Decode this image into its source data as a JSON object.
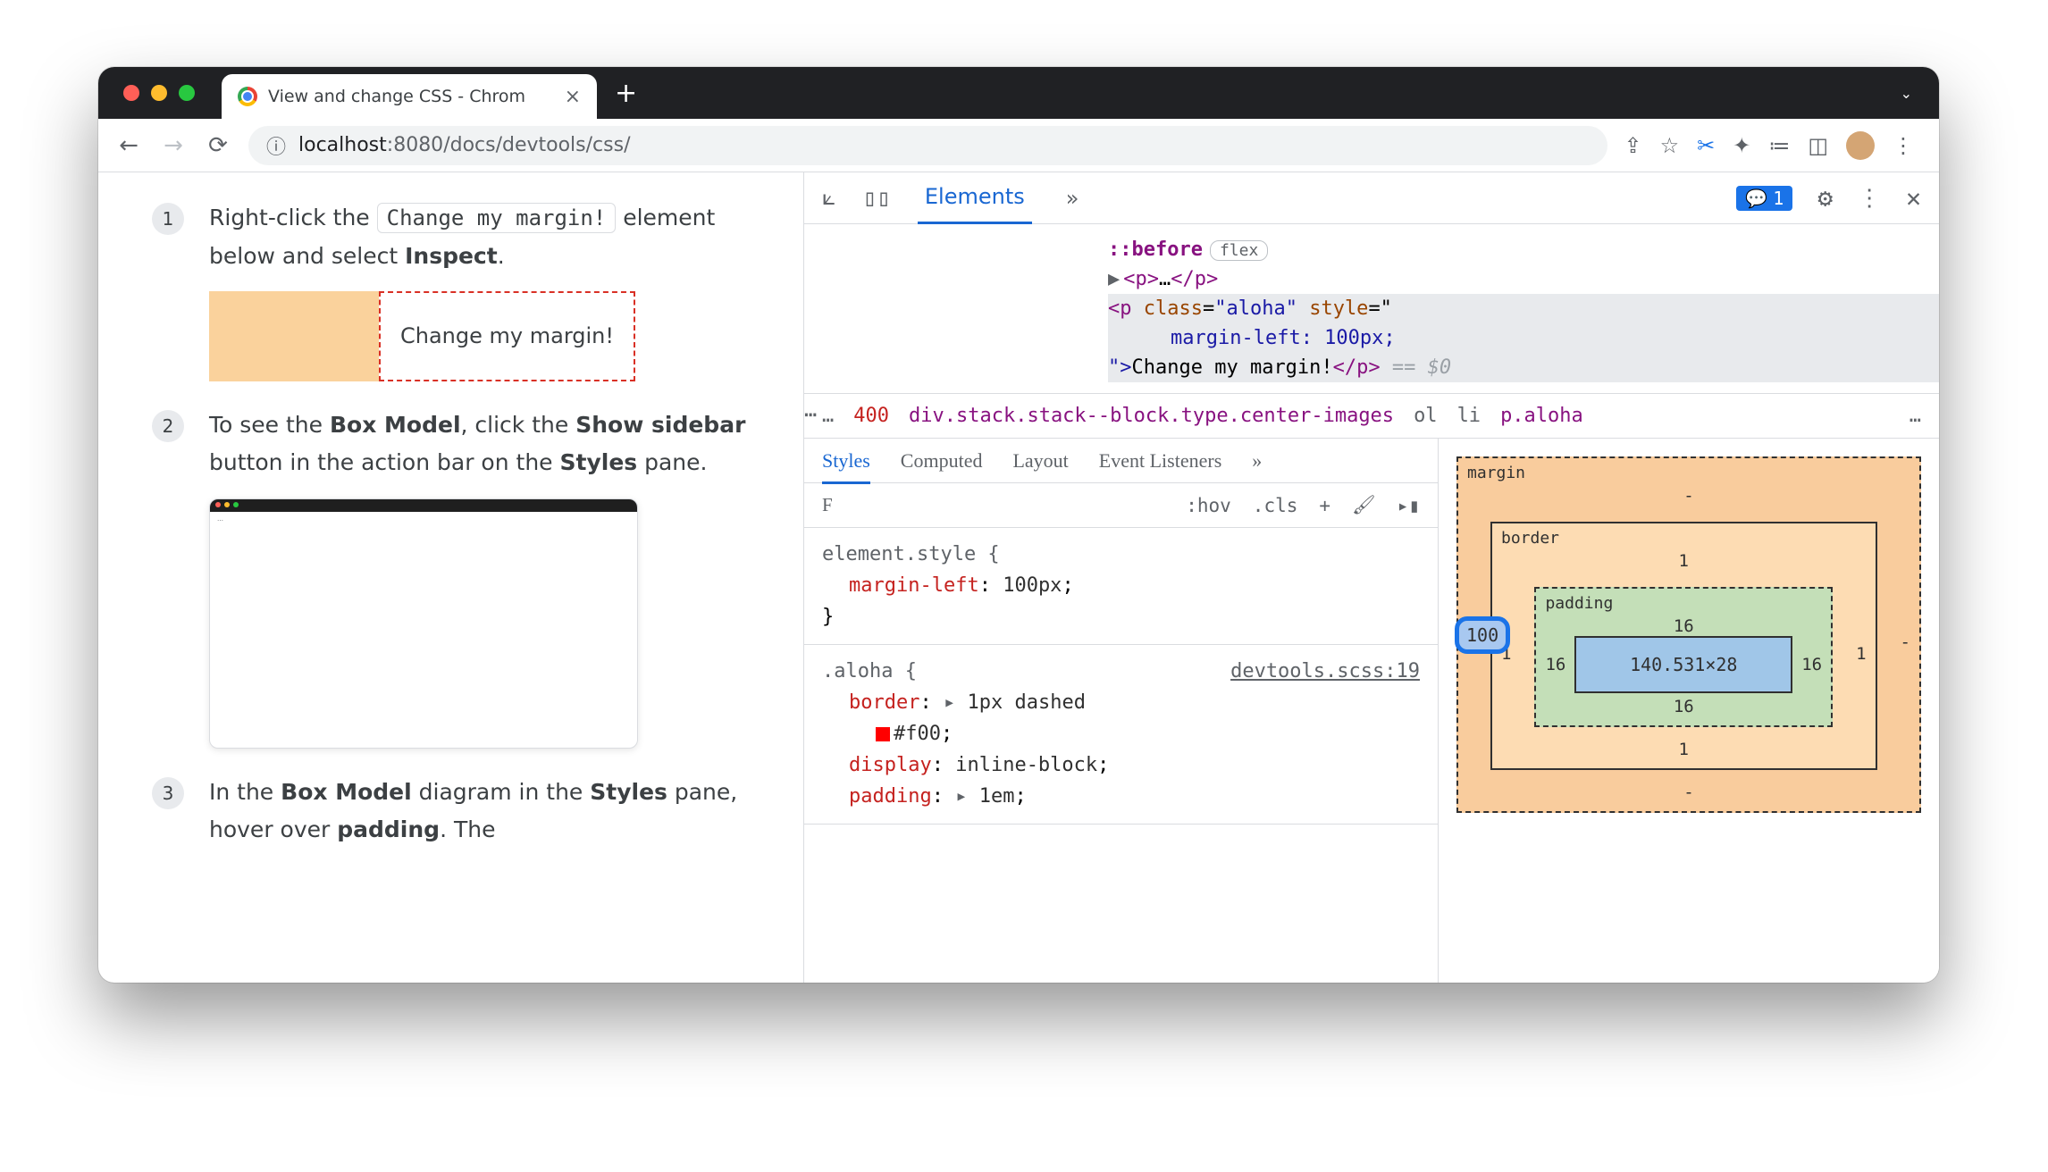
{
  "tab": {
    "title": "View and change CSS - Chrom"
  },
  "url": {
    "host": "localhost",
    "port": ":8080",
    "path": "/docs/devtools/css/"
  },
  "steps": {
    "s1": {
      "num": "1",
      "pre": "Right-click the ",
      "code": "Change my margin!",
      "post": " element below and select ",
      "bold": "Inspect",
      "dot": "."
    },
    "demo": "Change my margin!",
    "s2": {
      "num": "2",
      "t1": "To see the ",
      "b1": "Box Model",
      "t2": ", click the ",
      "b2": "Show sidebar",
      "t3": " button in the action bar on the ",
      "b3": "Styles",
      "t4": " pane."
    },
    "s3": {
      "num": "3",
      "t1": "In the ",
      "b1": "Box Model",
      "t2": " diagram in the ",
      "b2": "Styles",
      "t3": " pane, hover over ",
      "b3": "padding",
      "t4": ". The"
    }
  },
  "devtools": {
    "tabs": {
      "elements": "Elements"
    },
    "issues": "1",
    "dom": {
      "before": "::before",
      "flex": "flex",
      "p1a": "<p>",
      "p1b": "…",
      "p1c": "</p>",
      "sel_open": "<p ",
      "cls_attr": "class",
      "cls_val": "\"aloha\"",
      "sty_attr": "style",
      "sty_eq": "=\"",
      "sty_line": "margin-left: 100px;",
      "sty_close": "\">",
      "txt": "Change my margin!",
      "close": "</p>",
      "eq": " == ",
      "dollar": "$0"
    },
    "crumb": {
      "dots": "…",
      "n400": "400",
      "div": "div.stack.stack--block.type.center-images",
      "ol": "ol",
      "li": "li",
      "p": "p.aloha",
      "more": "…"
    },
    "styles_tabs": {
      "styles": "Styles",
      "computed": "Computed",
      "layout": "Layout",
      "events": "Event Listeners"
    },
    "styles_bar": {
      "filter": "F",
      "hov": ":hov",
      "cls": ".cls",
      "plus": "+"
    },
    "rule1": {
      "sel": "element.style {",
      "prop": "margin-left",
      "val": "100px",
      "close": "}"
    },
    "rule2": {
      "sel": ".aloha {",
      "src": "devtools.scss:19",
      "border": "border",
      "bval": "1px dashed",
      "color": "#f00",
      "display": "display",
      "dval": "inline-block",
      "padding": "padding",
      "pval": "1em"
    },
    "box": {
      "margin": "margin",
      "border": "border",
      "padding": "padding",
      "m_top": "-",
      "m_left": "100",
      "m_right": "-",
      "m_bottom": "-",
      "b_top": "1",
      "b_left": "1",
      "b_right": "1",
      "b_bottom": "1",
      "p_top": "16",
      "p_left": "16",
      "p_right": "16",
      "p_bottom": "16",
      "content": "140.531×28"
    }
  }
}
